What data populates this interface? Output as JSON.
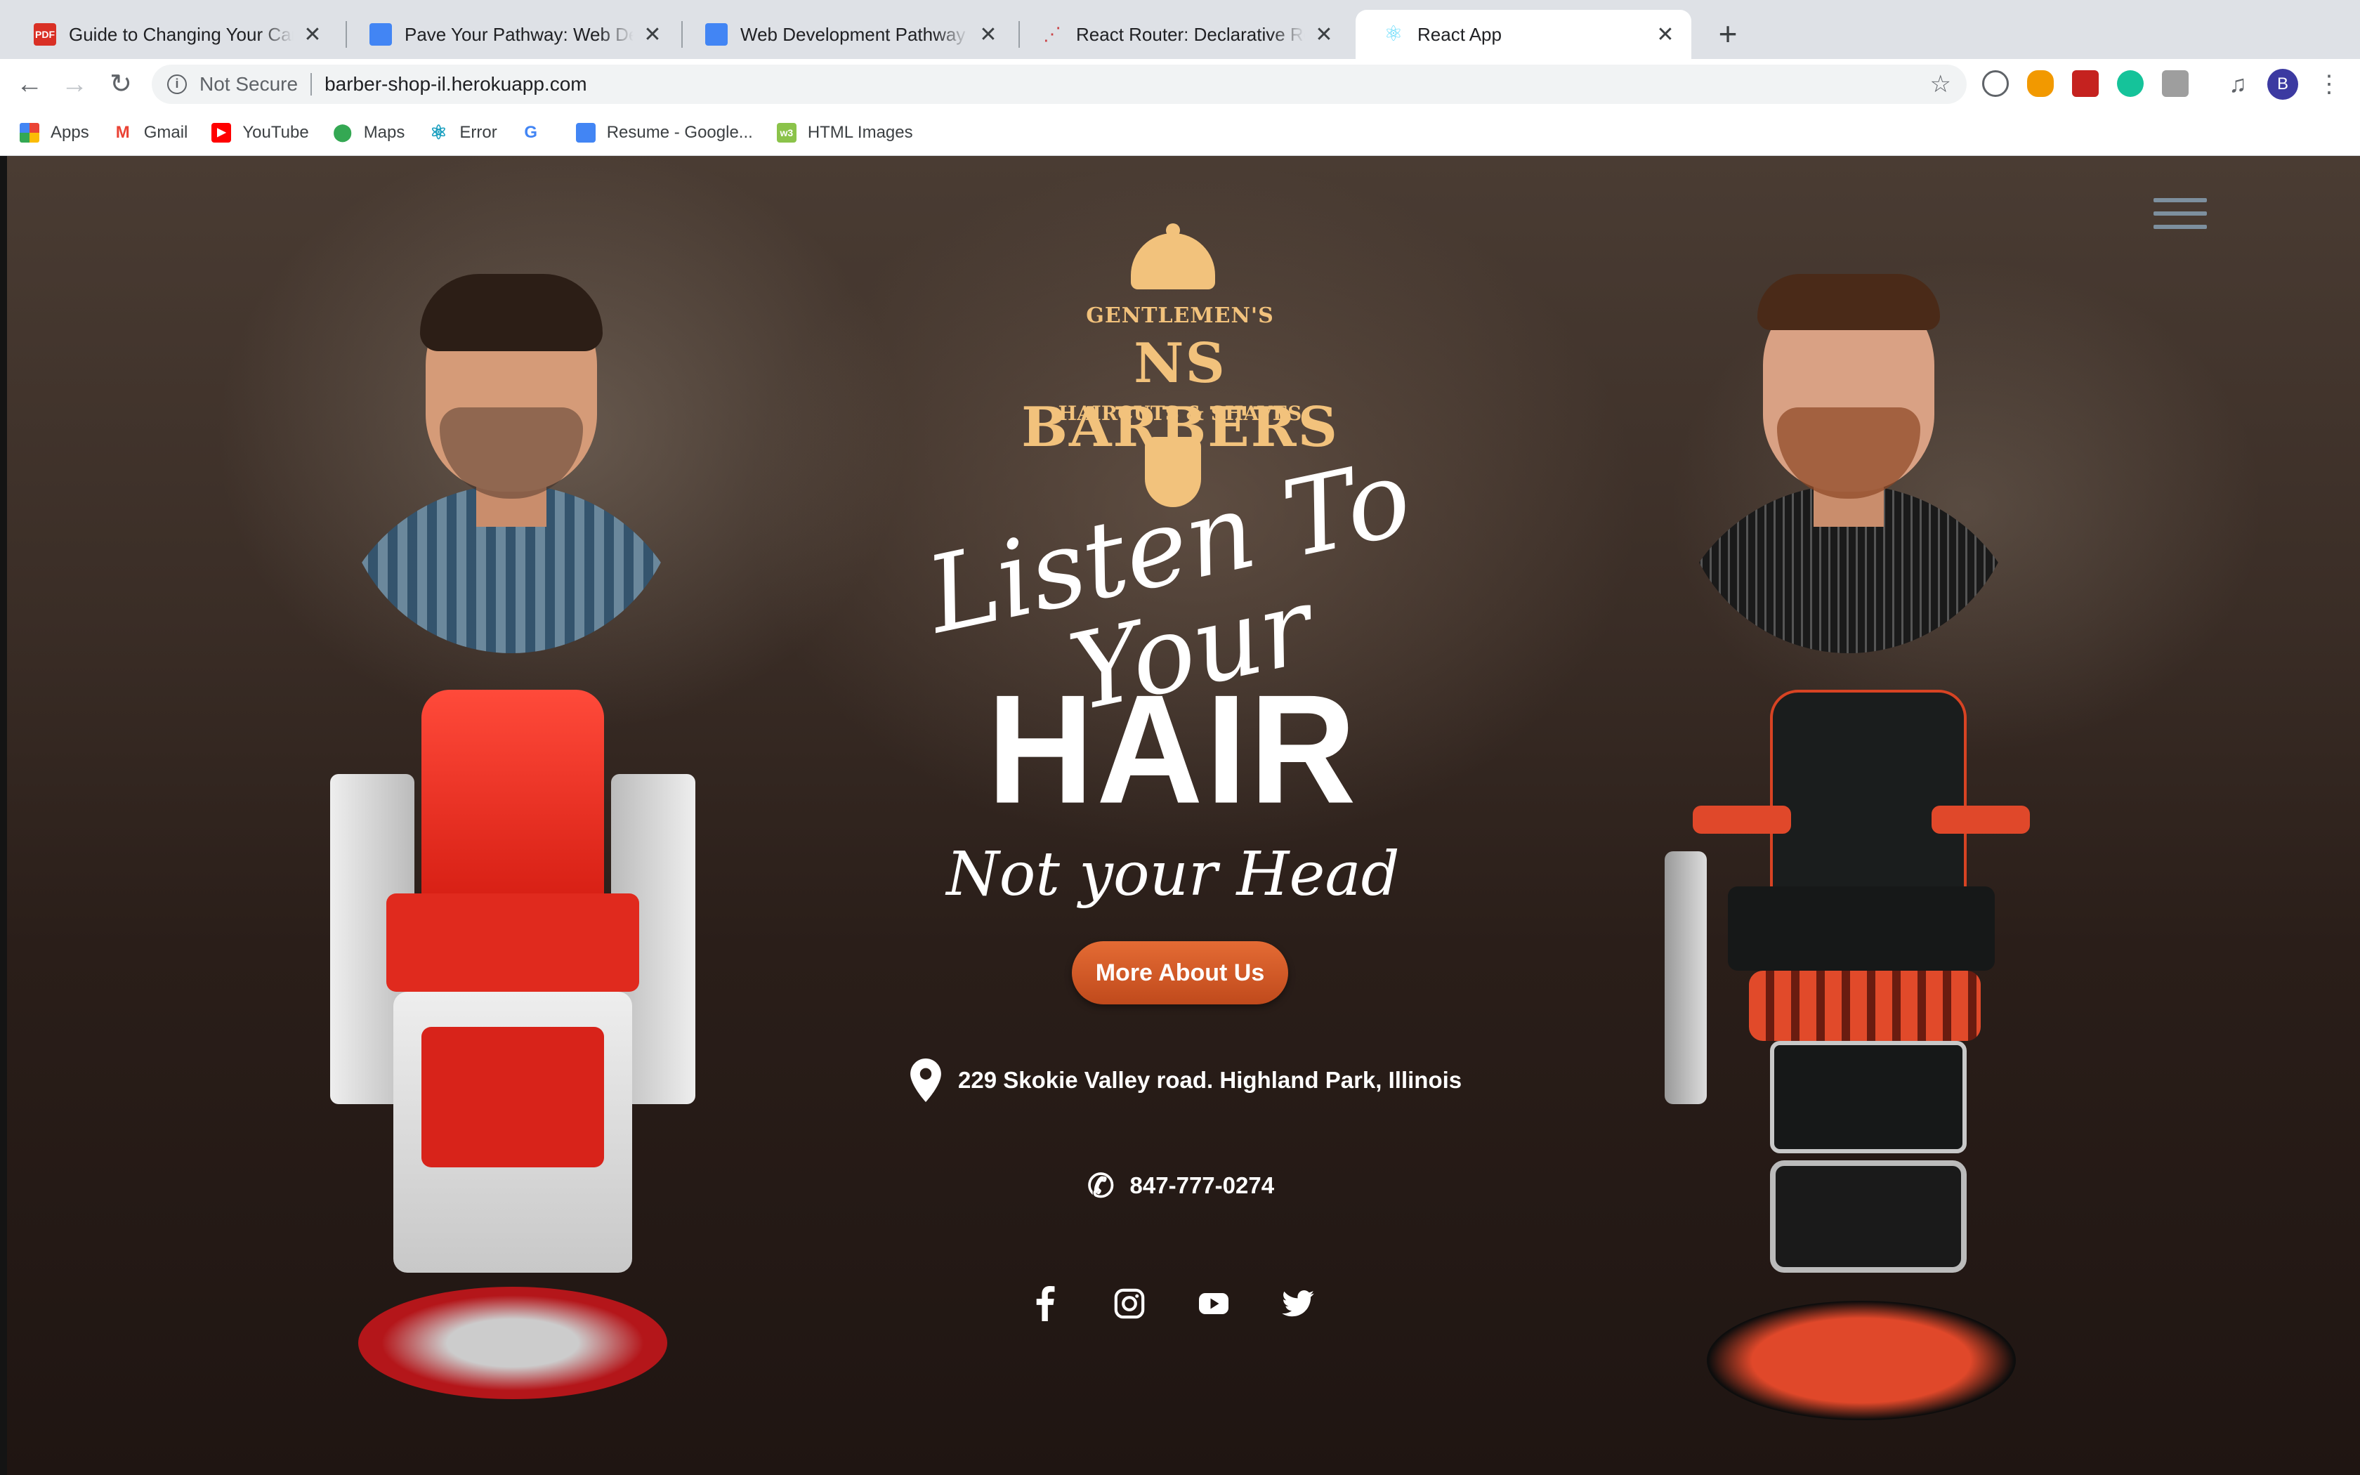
{
  "browser": {
    "tabs": [
      {
        "title": "Guide to Changing Your Career",
        "favicon": "pdf-icon"
      },
      {
        "title": "Pave Your Pathway: Web Dev C",
        "favicon": "google-docs-icon"
      },
      {
        "title": "Web Development Pathway - G",
        "favicon": "google-docs-icon"
      },
      {
        "title": "React Router: Declarative Rout",
        "favicon": "react-router-icon"
      },
      {
        "title": "React App",
        "favicon": "react-icon",
        "active": true
      }
    ],
    "security_label": "Not Secure",
    "url": "barber-shop-il.herokuapp.com",
    "profile_initial": "B",
    "bookmarks": [
      {
        "label": "Apps",
        "icon": "apps-grid-icon"
      },
      {
        "label": "Gmail",
        "icon": "gmail-icon"
      },
      {
        "label": "YouTube",
        "icon": "youtube-icon"
      },
      {
        "label": "Maps",
        "icon": "maps-icon"
      },
      {
        "label": "Error",
        "icon": "react-icon"
      },
      {
        "label": "",
        "icon": "google-icon"
      },
      {
        "label": "Resume - Google...",
        "icon": "google-docs-icon"
      },
      {
        "label": "HTML Images",
        "icon": "w3schools-icon"
      }
    ]
  },
  "site": {
    "logo": {
      "top": "GENTLEMEN'S",
      "name": "NS BARBERS",
      "bottom": "HAIRCUTS & SHAVES"
    },
    "tagline": {
      "line1": "Listen To Your",
      "line2": "HAIR",
      "line3": "Not your Head"
    },
    "cta_label": "More About Us",
    "address": "229 Skokie Valley road. Highland Park, Illinois",
    "phone": "847-777-0274",
    "social": [
      "facebook-icon",
      "instagram-icon",
      "youtube-icon",
      "twitter-icon"
    ],
    "colors": {
      "logo_gold": "#f2c27c",
      "cta_orange": "#d85a28",
      "background": "#2a1e19"
    }
  }
}
